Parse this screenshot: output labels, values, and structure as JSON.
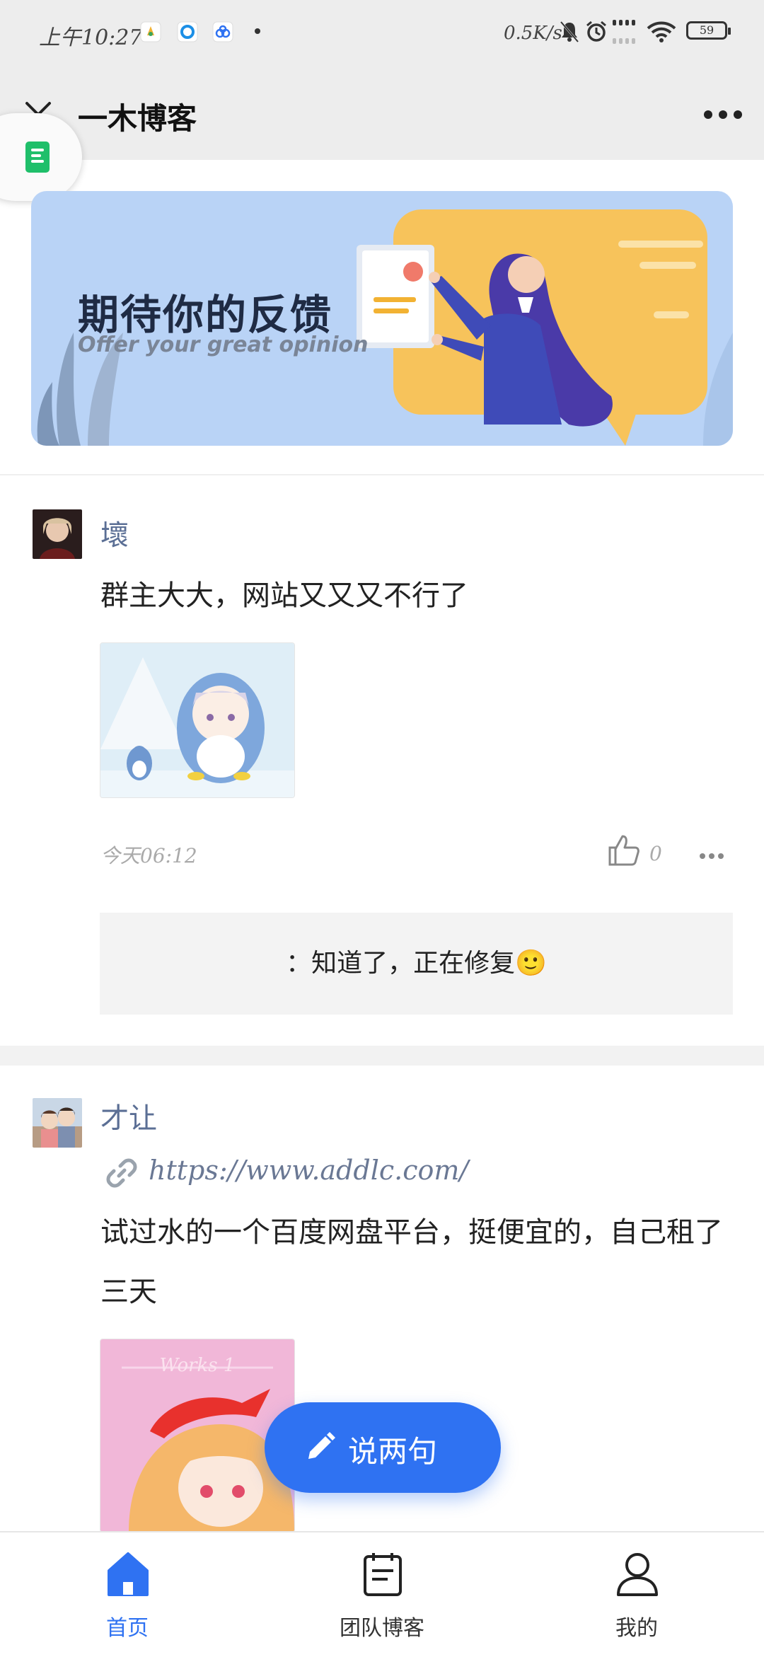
{
  "status_bar": {
    "time": "上午10:27",
    "network_speed": "0.5K/s",
    "battery": "59",
    "icons": [
      "app-notification-icon",
      "browser-icon",
      "cloud-icon",
      "mute-icon",
      "alarm-icon",
      "signal-icon",
      "wifi-icon",
      "battery-icon"
    ]
  },
  "header": {
    "title": "一木博客",
    "close_icon": "close-icon",
    "more_icon": "more-dots-icon"
  },
  "floating_widget": {
    "icon": "document-icon"
  },
  "banner": {
    "title": "期待你的反馈",
    "subtitle": "Offer your great opinion"
  },
  "posts": [
    {
      "author": "壞",
      "content": "群主大大，网站又又又不行了",
      "timestamp": "今天06:12",
      "likes": "0",
      "reply": "：知道了，正在修复🙂"
    },
    {
      "author": "才让",
      "link": "https://www.addlc.com/",
      "content_line1": "试过水的一个百度网盘平台，挺便宜的，自己租了",
      "content_line2": "三天",
      "image_caption": "Works 1"
    }
  ],
  "fab": {
    "label": "说两句",
    "icon": "pencil-icon"
  },
  "bottom_nav": [
    {
      "label": "首页",
      "icon": "home-icon",
      "active": true
    },
    {
      "label": "团队博客",
      "icon": "notepad-icon",
      "active": false
    },
    {
      "label": "我的",
      "icon": "user-icon",
      "active": false
    }
  ],
  "colors": {
    "accent": "#2f72f2",
    "author": "#5b6f95",
    "banner_bg": "#b9d3f6",
    "header_bg": "#ededed"
  }
}
